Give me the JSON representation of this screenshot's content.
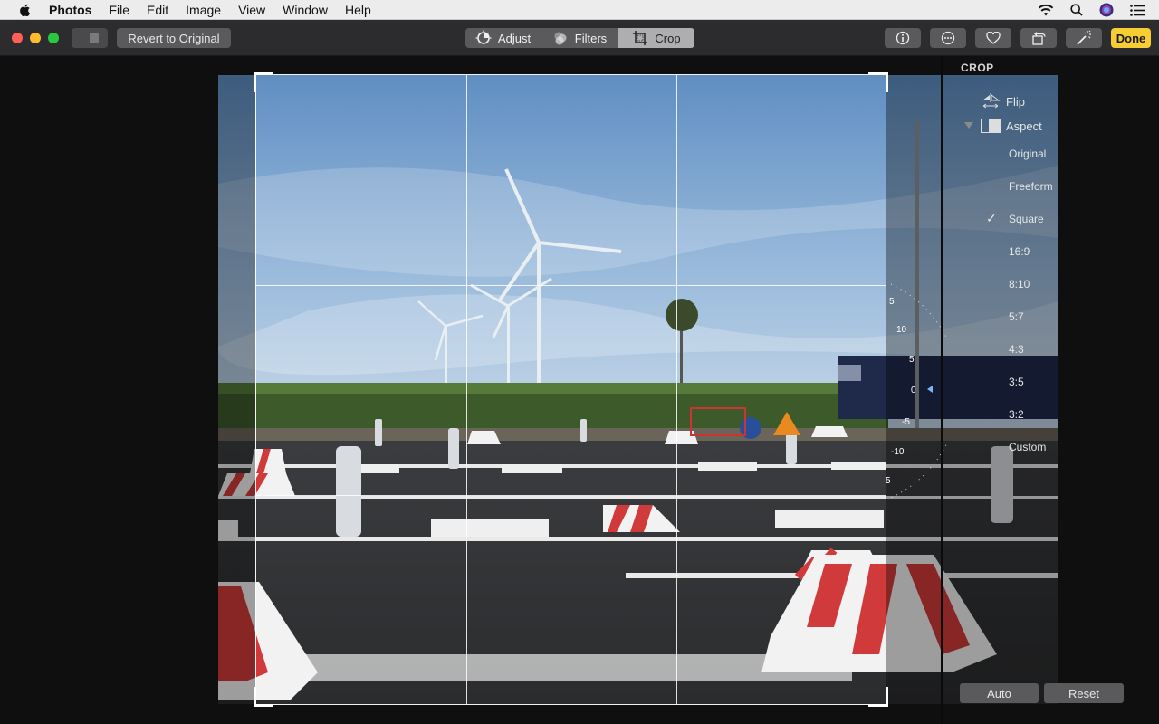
{
  "menubar": {
    "app": "Photos",
    "items": [
      "File",
      "Edit",
      "Image",
      "View",
      "Window",
      "Help"
    ],
    "status_icons": [
      "wifi-icon",
      "search-icon",
      "siri-icon",
      "notification-list-icon"
    ]
  },
  "toolbar": {
    "revert_label": "Revert to Original",
    "tabs": [
      {
        "label": "Adjust",
        "icon": "adjust-dial-icon"
      },
      {
        "label": "Filters",
        "icon": "filters-circles-icon"
      },
      {
        "label": "Crop",
        "icon": "crop-icon"
      }
    ],
    "active_tab": "Crop",
    "tool_icons": [
      "info-icon",
      "more-icon",
      "heart-icon",
      "rotate-icon",
      "magic-wand-icon"
    ],
    "done_label": "Done",
    "done_color": "#f6cd32"
  },
  "rotation_dial": {
    "ticks": [
      "5",
      "10",
      "5",
      "0",
      "-5",
      "-10",
      "5"
    ]
  },
  "sidebar": {
    "title": "CROP",
    "flip_label": "Flip",
    "aspect_label": "Aspect",
    "aspect_options": [
      "Original",
      "Freeform",
      "Square",
      "16:9",
      "8:10",
      "5:7",
      "4:3",
      "3:5",
      "3:2",
      "Custom"
    ],
    "selected_aspect": "Square",
    "auto_label": "Auto",
    "reset_label": "Reset"
  }
}
